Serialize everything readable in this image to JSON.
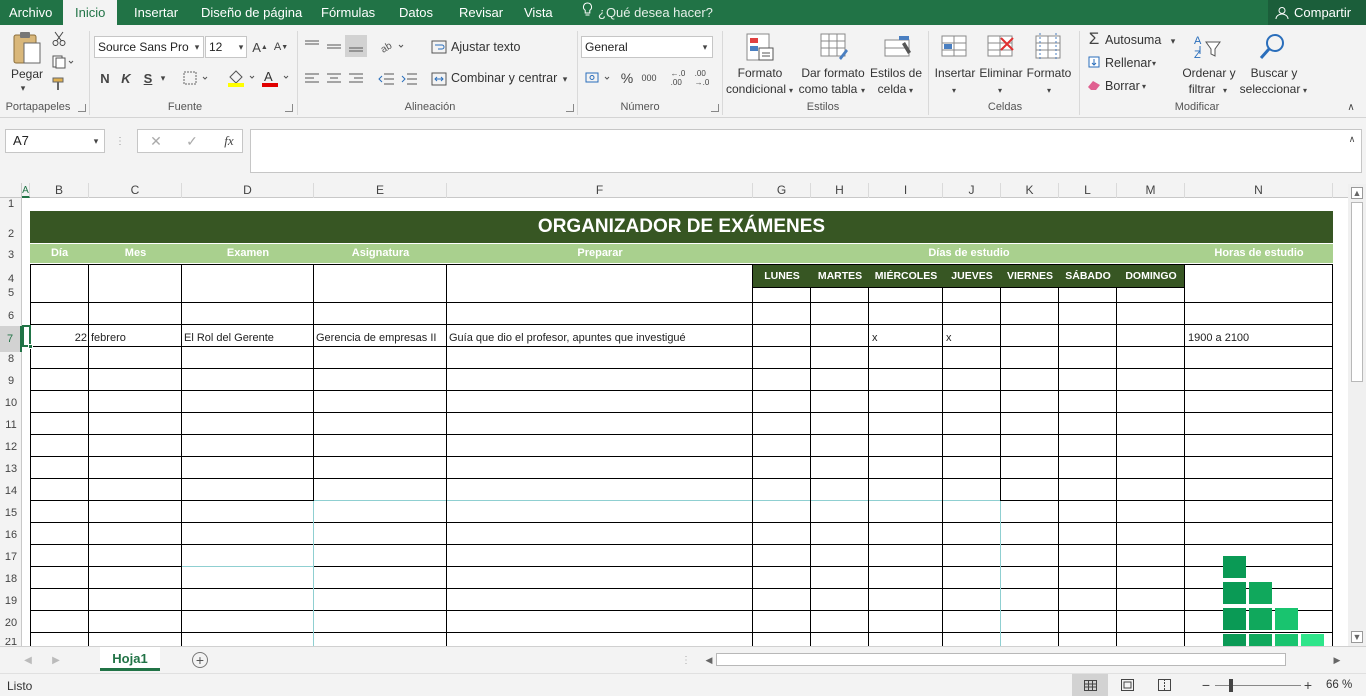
{
  "menu": {
    "file": "Archivo",
    "tabs": [
      "Inicio",
      "Insertar",
      "Diseño de página",
      "Fórmulas",
      "Datos",
      "Revisar",
      "Vista"
    ],
    "search_hint": "¿Qué desea hacer?",
    "share": "Compartir"
  },
  "ribbon": {
    "clipboard": {
      "paste": "Pegar",
      "label": "Portapapeles"
    },
    "font": {
      "name": "Source Sans Pro",
      "size": "12",
      "bold": "N",
      "italic": "K",
      "underline": "S",
      "label": "Fuente"
    },
    "alignment": {
      "wrap": "Ajustar texto",
      "merge": "Combinar y centrar",
      "label": "Alineación"
    },
    "number": {
      "format": "General",
      "percent": "%",
      "thousands": "000",
      "label": "Número"
    },
    "styles": {
      "conditional_1": "Formato",
      "conditional_2": "condicional",
      "table_1": "Dar formato",
      "table_2": "como tabla",
      "cell_1": "Estilos de",
      "cell_2": "celda",
      "label": "Estilos"
    },
    "cells": {
      "insert": "Insertar",
      "delete": "Eliminar",
      "format": "Formato",
      "label": "Celdas"
    },
    "editing": {
      "autosum": "Autosuma",
      "fill": "Rellenar",
      "clear": "Borrar",
      "sort_1": "Ordenar y",
      "sort_2": "filtrar",
      "find_1": "Buscar y",
      "find_2": "seleccionar",
      "label": "Modificar"
    }
  },
  "formula_bar": {
    "name_box": "A7",
    "fx": "fx",
    "content": ""
  },
  "sheet": {
    "columns": [
      "A",
      "B",
      "C",
      "D",
      "E",
      "F",
      "G",
      "H",
      "I",
      "J",
      "K",
      "L",
      "M",
      "N"
    ],
    "rows": [
      "1",
      "2",
      "3",
      "4",
      "5",
      "6",
      "7",
      "8",
      "9",
      "10",
      "11",
      "12",
      "13",
      "14",
      "15",
      "16",
      "17",
      "18",
      "19",
      "20",
      "21"
    ],
    "title": "ORGANIZADOR DE EXÁMENES",
    "headers": {
      "dia": "Día",
      "mes": "Mes",
      "examen": "Examen",
      "asignatura": "Asignatura",
      "preparar": "Preparar",
      "dias_estudio": "Días de estudio",
      "horas_estudio": "Horas de estudio"
    },
    "weekdays": [
      "LUNES",
      "MARTES",
      "MIÉRCOLES",
      "JUEVES",
      "VIERNES",
      "SÁBADO",
      "DOMINGO"
    ],
    "entry": {
      "dia": "22",
      "mes": "febrero",
      "examen": "El Rol del Gerente",
      "asignatura": "Gerencia de empresas II",
      "preparar": "Guía que dio el profesor, apuntes que investigué",
      "miercoles": "x",
      "jueves": "x",
      "horas": "1900 a 2100"
    }
  },
  "sheet_tabs": {
    "active": "Hoja1"
  },
  "status": {
    "ready": "Listo",
    "zoom": "66 %"
  },
  "colors": {
    "excel_green": "#217346",
    "title_bg": "#375623",
    "header_bg": "#a9d08e",
    "weekday_bg": "#375623"
  }
}
